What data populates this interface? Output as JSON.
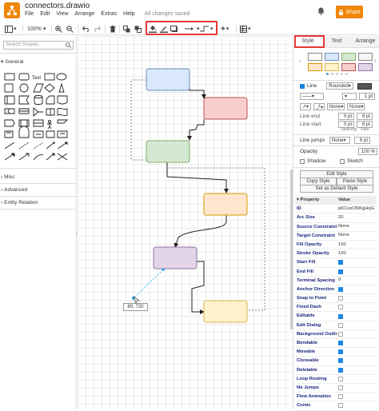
{
  "app": {
    "filename": "connectors.drawio",
    "menu": [
      "File",
      "Edit",
      "View",
      "Arrange",
      "Extras",
      "Help"
    ],
    "save_status": "All changes saved",
    "share_label": "Share"
  },
  "toolbar": {
    "zoom": "100%"
  },
  "sidebar": {
    "search_placeholder": "Search Shapes",
    "sections": [
      "General",
      "Misc",
      "Advanced",
      "Entity Relation"
    ],
    "text_shape_label": "Text"
  },
  "canvas": {
    "coord_tooltip": "80, 720"
  },
  "panel": {
    "tabs": [
      "Style",
      "Text",
      "Arrange"
    ],
    "swatch_colors": [
      "#ffffff",
      "#dae8fc",
      "#d5e8d4",
      "#f5f5f5",
      "#ffe6cc",
      "#fff2cc",
      "#f8cecc",
      "#e1d5e7"
    ],
    "line_label": "Line",
    "line_style": "Rounded",
    "line_width": "1 pt",
    "arrow_none_1": "None",
    "arrow_none_2": "None",
    "line_end_label": "Line end",
    "line_end_value": "0 pt",
    "line_end_size": "6 pt",
    "line_start_label": "Line start",
    "line_start_value": "0 pt",
    "line_start_size": "6 pt",
    "spacing_label": "Spacing",
    "size_label": "Size",
    "line_jumps_label": "Line jumps",
    "line_jumps_value": "None",
    "line_jumps_size": "6 pt",
    "opacity_label": "Opacity",
    "opacity_value": "100 %",
    "shadow_label": "Shadow",
    "sketch_label": "Sketch",
    "edit_style": "Edit Style",
    "copy_style": "Copy Style",
    "paste_style": "Paste Style",
    "set_default": "Set as Default Style",
    "prop_header": "Property",
    "value_header": "Value"
  },
  "properties": [
    {
      "k": "ID",
      "v": "pKCsoONKgHqG",
      "t": "text"
    },
    {
      "k": "Arc Size",
      "v": "20",
      "t": "text"
    },
    {
      "k": "Source Constraint",
      "v": "None",
      "t": "text"
    },
    {
      "k": "Target Constraint",
      "v": "None",
      "t": "text"
    },
    {
      "k": "Fill Opacity",
      "v": "100",
      "t": "text"
    },
    {
      "k": "Stroke Opacity",
      "v": "100",
      "t": "text"
    },
    {
      "k": "Start Fill",
      "v": "",
      "t": "on"
    },
    {
      "k": "End Fill",
      "v": "",
      "t": "on"
    },
    {
      "k": "Terminal Spacing",
      "v": "0",
      "t": "text"
    },
    {
      "k": "Anchor Direction",
      "v": "",
      "t": "on"
    },
    {
      "k": "Snap to Point",
      "v": "",
      "t": "off"
    },
    {
      "k": "Fixed Dash",
      "v": "",
      "t": "off"
    },
    {
      "k": "Editable",
      "v": "",
      "t": "on"
    },
    {
      "k": "Edit Dialog",
      "v": "",
      "t": "off"
    },
    {
      "k": "Background Outline",
      "v": "",
      "t": "off"
    },
    {
      "k": "Bendable",
      "v": "",
      "t": "on"
    },
    {
      "k": "Movable",
      "v": "",
      "t": "on"
    },
    {
      "k": "Cloneable",
      "v": "",
      "t": "on"
    },
    {
      "k": "Deletable",
      "v": "",
      "t": "on"
    },
    {
      "k": "Loop Routing",
      "v": "",
      "t": "off"
    },
    {
      "k": "No Jumps",
      "v": "",
      "t": "off"
    },
    {
      "k": "Flow Animation",
      "v": "",
      "t": "off"
    },
    {
      "k": "Comic",
      "v": "",
      "t": "off"
    }
  ],
  "colors": {
    "accent": "#f08705",
    "highlight": "#e53935",
    "check_blue": "#1e88e5"
  }
}
